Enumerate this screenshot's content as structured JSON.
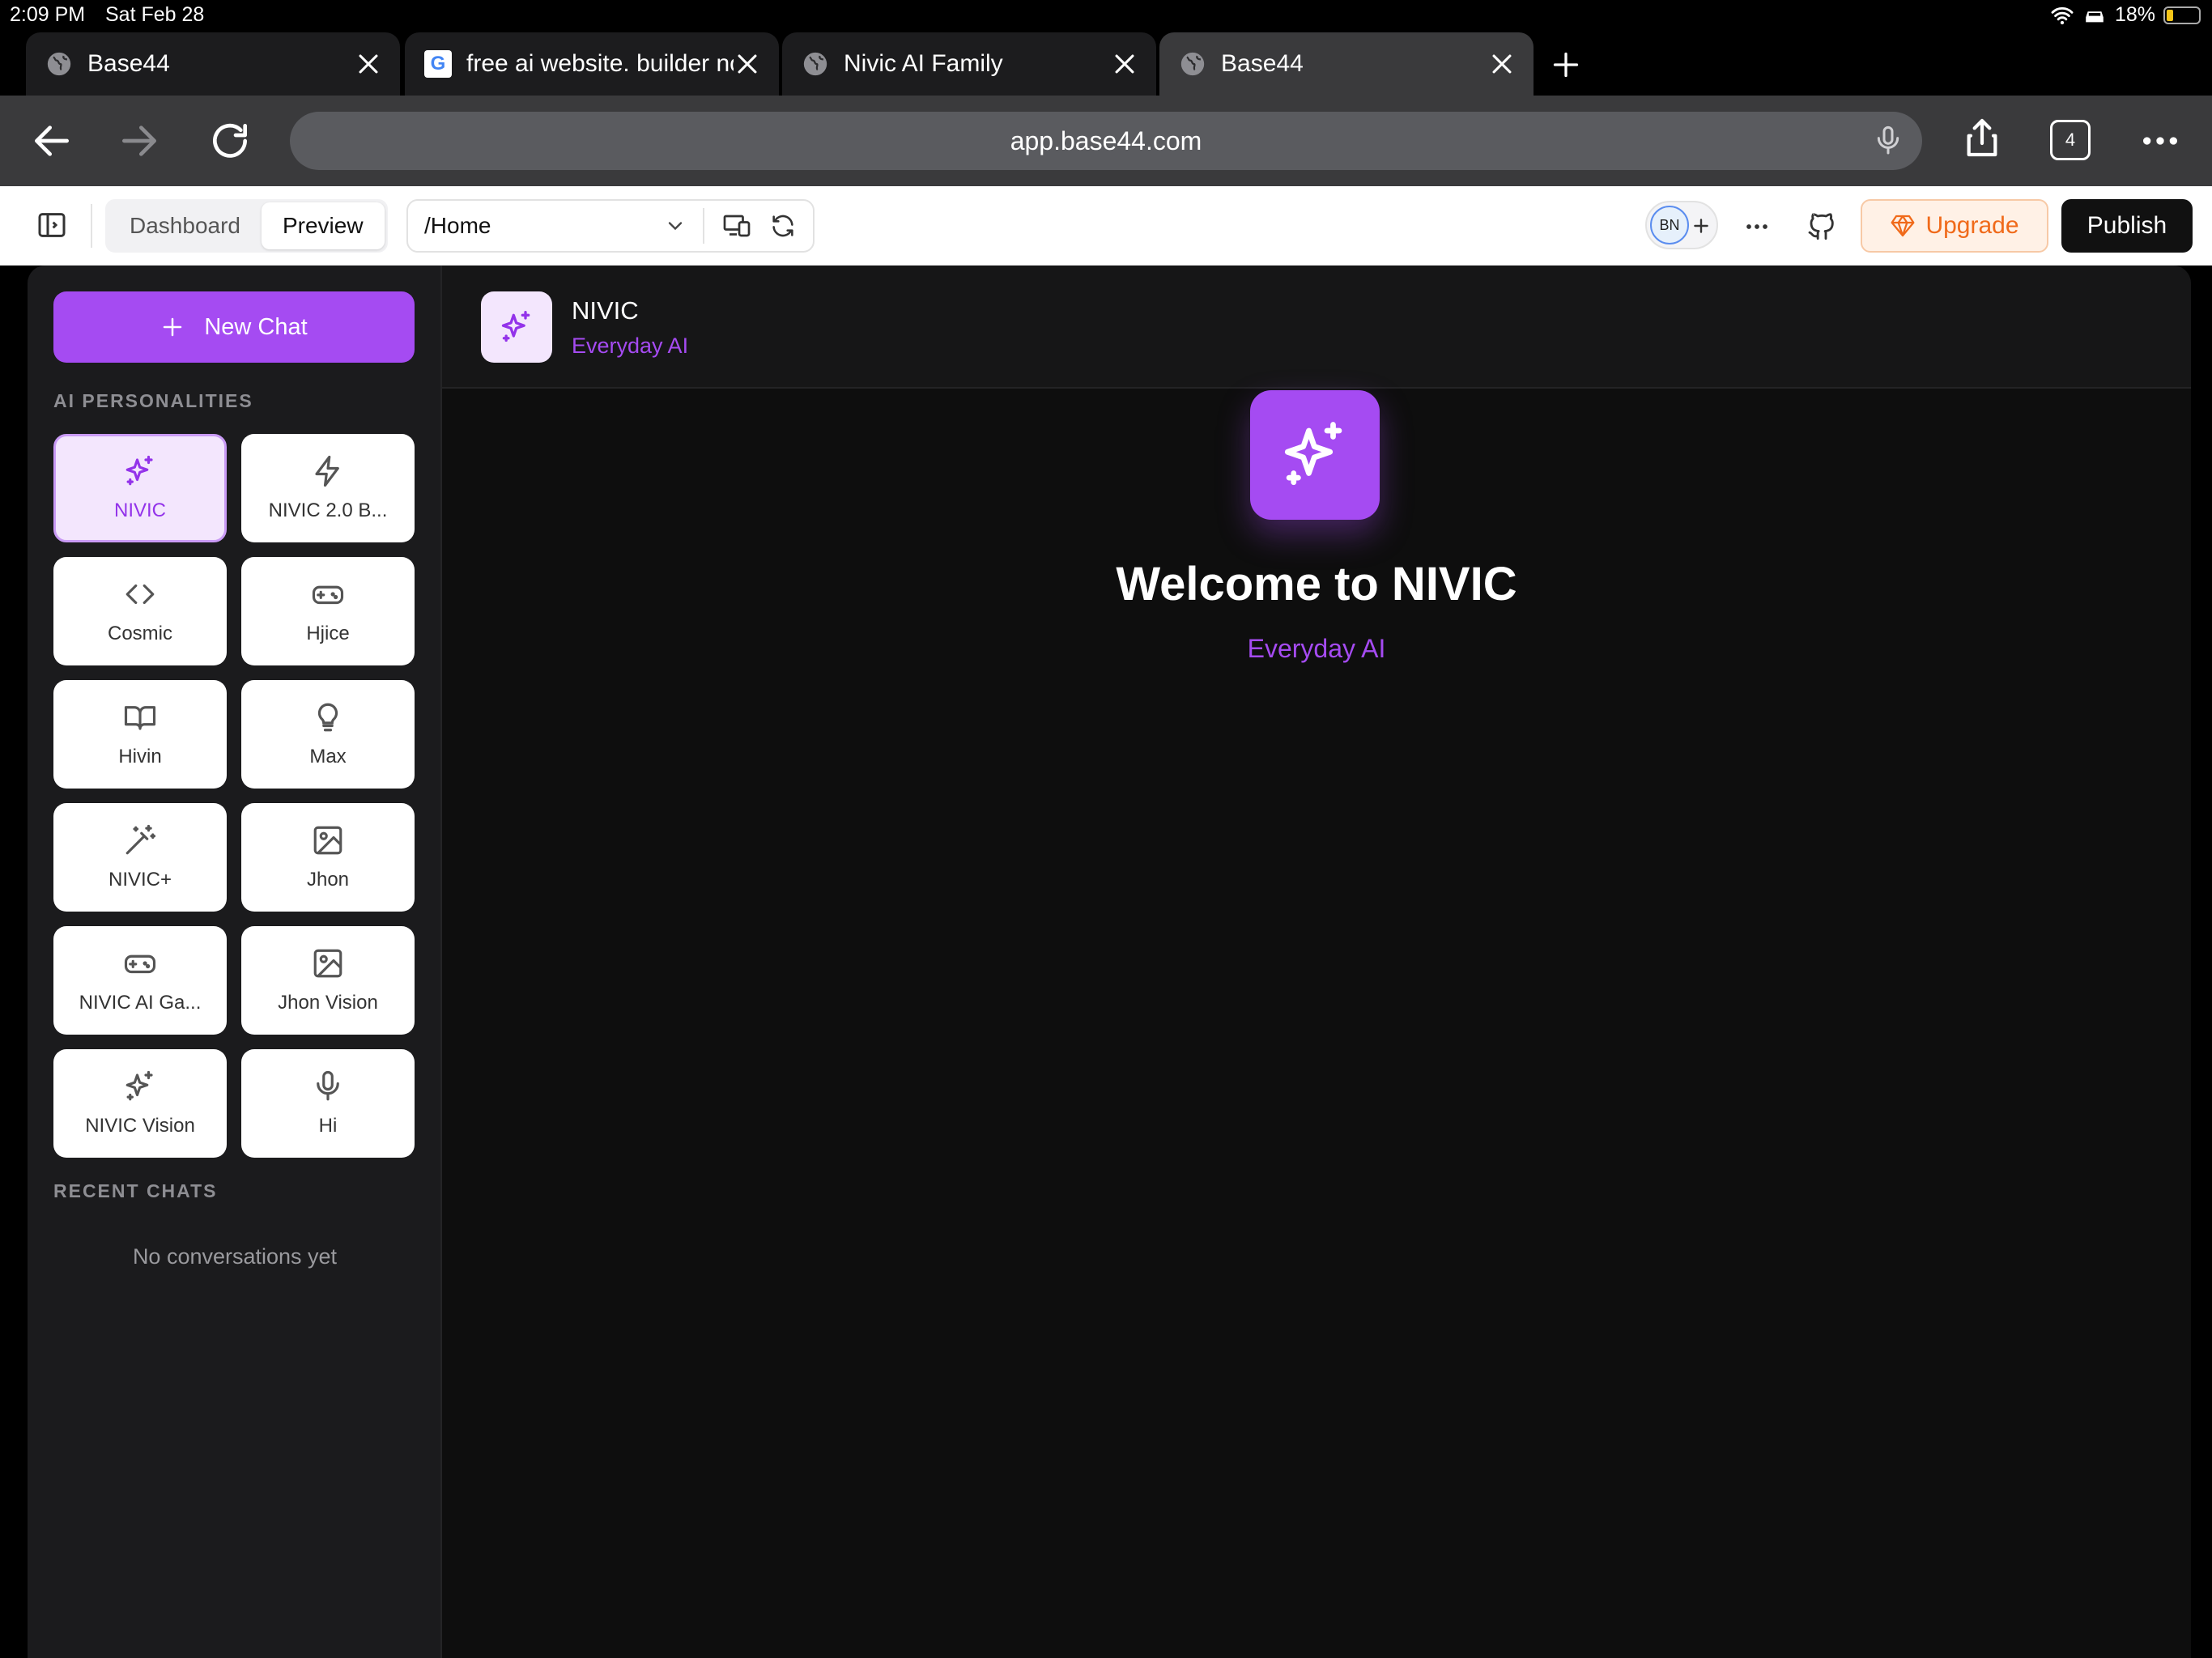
{
  "status": {
    "time": "2:09 PM",
    "date": "Sat Feb 28",
    "battery": "18%",
    "battery_level": 0.18
  },
  "tabs": [
    {
      "title": "Base44",
      "icon": "globe-icon",
      "active": false
    },
    {
      "title": "free ai website. builder no",
      "icon": "google-icon",
      "active": false
    },
    {
      "title": "Nivic AI Family",
      "icon": "globe-icon",
      "active": false
    },
    {
      "title": "Base44",
      "icon": "globe-icon",
      "active": true
    }
  ],
  "browser": {
    "url": "app.base44.com",
    "tab_count": "4",
    "google_letter": "G"
  },
  "toolbar": {
    "dashboard_label": "Dashboard",
    "preview_label": "Preview",
    "route": "/Home",
    "avatar_initials": "BN",
    "upgrade_label": "Upgrade",
    "publish_label": "Publish"
  },
  "sidebar": {
    "new_chat_label": "New Chat",
    "personalities_title": "AI PERSONALITIES",
    "personalities": [
      {
        "label": "NIVIC",
        "icon": "sparkles-icon",
        "selected": true
      },
      {
        "label": "NIVIC 2.0 B...",
        "icon": "lightning-icon",
        "selected": false
      },
      {
        "label": "Cosmic",
        "icon": "code-icon",
        "selected": false
      },
      {
        "label": "Hjice",
        "icon": "gamepad-icon",
        "selected": false
      },
      {
        "label": "Hivin",
        "icon": "book-icon",
        "selected": false
      },
      {
        "label": "Max",
        "icon": "lightbulb-icon",
        "selected": false
      },
      {
        "label": "NIVIC+",
        "icon": "magic-wand-icon",
        "selected": false
      },
      {
        "label": "Jhon",
        "icon": "image-icon",
        "selected": false
      },
      {
        "label": "NIVIC AI Ga...",
        "icon": "gamepad-icon",
        "selected": false
      },
      {
        "label": "Jhon Vision",
        "icon": "image-icon",
        "selected": false
      },
      {
        "label": "NIVIC Vision",
        "icon": "sparkles-icon",
        "selected": false
      },
      {
        "label": "Hi",
        "icon": "microphone-icon",
        "selected": false
      }
    ],
    "recent_title": "RECENT CHATS",
    "empty_text": "No conversations yet"
  },
  "main": {
    "header_title": "NIVIC",
    "header_subtitle": "Everyday AI",
    "welcome": "Welcome to NIVIC",
    "welcome_sub": "Everyday AI"
  },
  "colors": {
    "accent": "#a54bf2",
    "upgrade": "#f06a1a",
    "app_bg": "#0e0e0e"
  }
}
